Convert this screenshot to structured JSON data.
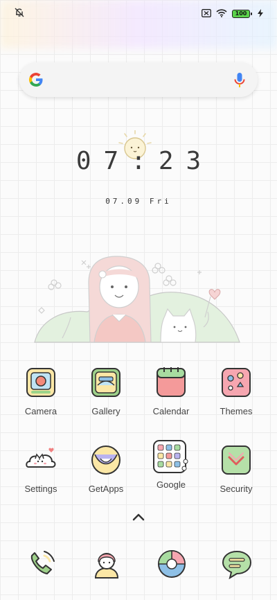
{
  "status": {
    "battery": "100"
  },
  "clock": {
    "time": "07:23",
    "date": "07.09 Fri"
  },
  "apps": [
    {
      "label": "Camera",
      "icon": "camera-icon"
    },
    {
      "label": "Gallery",
      "icon": "gallery-icon"
    },
    {
      "label": "Calendar",
      "icon": "calendar-icon"
    },
    {
      "label": "Themes",
      "icon": "themes-icon"
    },
    {
      "label": "Settings",
      "icon": "settings-icon"
    },
    {
      "label": "GetApps",
      "icon": "getapps-icon"
    },
    {
      "label": "Google",
      "icon": "google-folder-icon"
    },
    {
      "label": "Security",
      "icon": "security-icon"
    }
  ],
  "dock": [
    "phone-icon",
    "contacts-icon",
    "browser-icon",
    "messages-icon"
  ]
}
